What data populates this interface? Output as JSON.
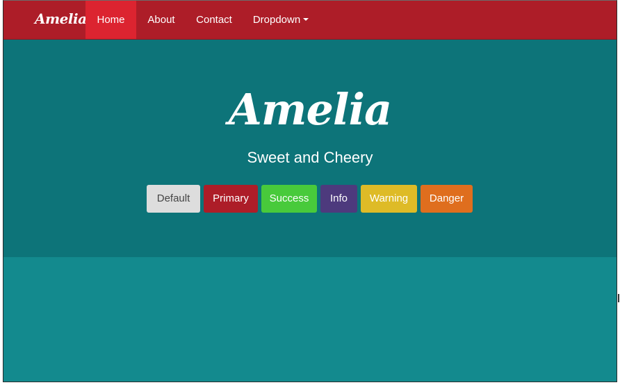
{
  "navbar": {
    "brand": "Amelia",
    "items": [
      {
        "label": "Home",
        "active": true
      },
      {
        "label": "About",
        "active": false
      },
      {
        "label": "Contact",
        "active": false
      },
      {
        "label": "Dropdown",
        "active": false,
        "icon": "caret-down-icon"
      }
    ]
  },
  "hero": {
    "title": "Amelia",
    "subtitle": "Sweet and Cheery",
    "buttons": [
      {
        "label": "Default",
        "color": "#dddddd",
        "text_color": "#444444"
      },
      {
        "label": "Primary",
        "color": "#ad1d28",
        "text_color": "#ffffff"
      },
      {
        "label": "Success",
        "color": "#48ca3b",
        "text_color": "#ffffff"
      },
      {
        "label": "Info",
        "color": "#4d3a7d",
        "text_color": "#ffffff"
      },
      {
        "label": "Warning",
        "color": "#debb27",
        "text_color": "#ffffff"
      },
      {
        "label": "Danger",
        "color": "#df6e1e",
        "text_color": "#ffffff"
      }
    ]
  },
  "colors": {
    "navbar": "#ad1d28",
    "nav_active": "#dc2430",
    "hero_bg": "#0d7479",
    "body_bg": "#138a8e"
  }
}
